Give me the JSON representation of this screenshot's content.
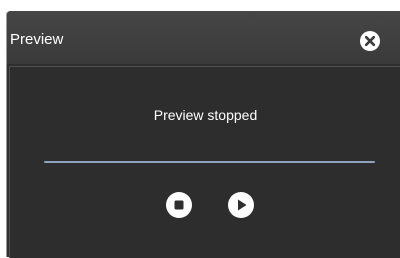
{
  "window": {
    "title": "Preview",
    "close_icon": "close-icon"
  },
  "preview": {
    "status": "Preview stopped",
    "progress": 0,
    "stop_icon": "stop-icon",
    "play_icon": "play-icon"
  },
  "colors": {
    "titlebar": "#404040",
    "panel": "#2d2d2d",
    "progress_track": "#8da3bf",
    "text": "#ffffff"
  }
}
